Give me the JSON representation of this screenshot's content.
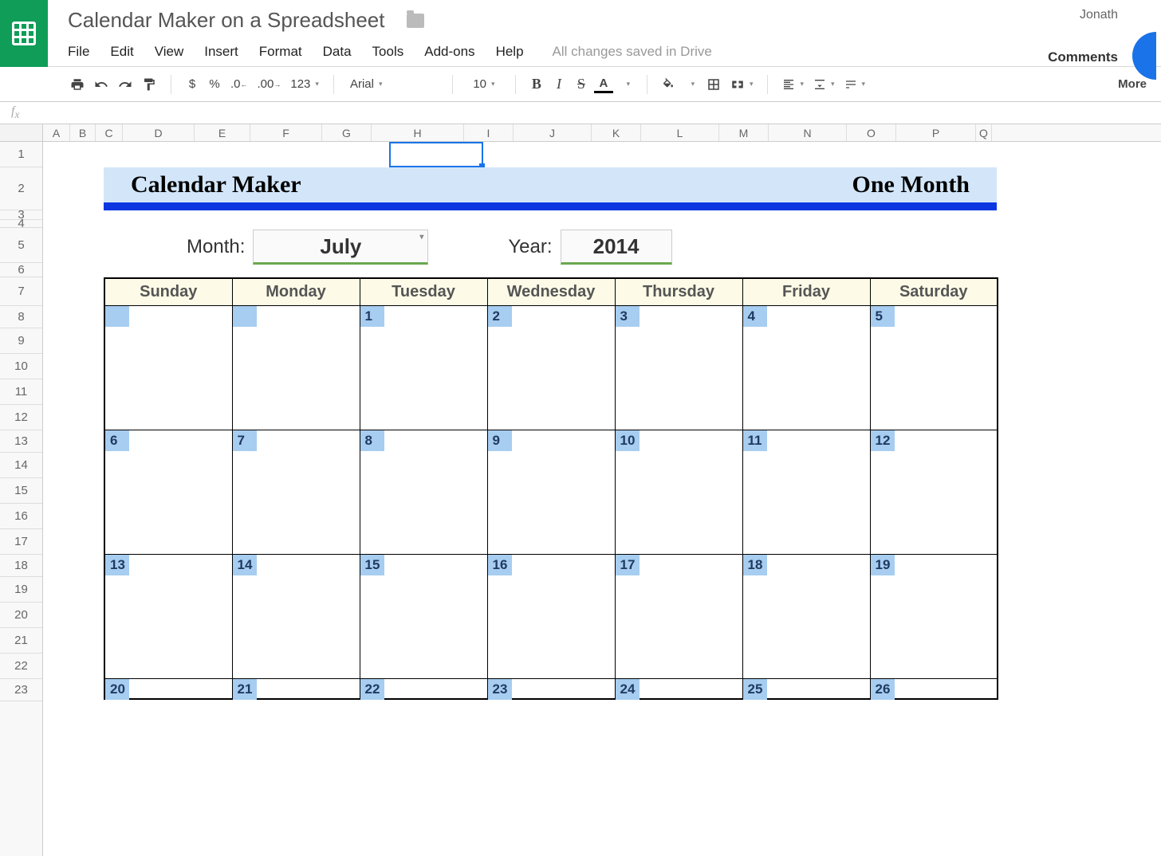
{
  "header": {
    "doc_title": "Calendar Maker on a Spreadsheet",
    "user": "Jonath",
    "comments": "Comments"
  },
  "menubar": [
    "File",
    "Edit",
    "View",
    "Insert",
    "Format",
    "Data",
    "Tools",
    "Add-ons",
    "Help"
  ],
  "save_status": "All changes saved in Drive",
  "toolbar": {
    "currency": "$",
    "percent": "%",
    "dec_dec": ".0",
    "dec_inc": ".00",
    "numfmt": "123",
    "font": "Arial",
    "size": "10",
    "bold": "B",
    "italic": "I",
    "strike": "S",
    "textA": "A",
    "more": "More"
  },
  "fx": "fx",
  "columns": [
    "A",
    "B",
    "C",
    "D",
    "E",
    "F",
    "G",
    "H",
    "I",
    "J",
    "K",
    "L",
    "M",
    "N",
    "O",
    "P",
    "Q"
  ],
  "rows": [
    "1",
    "2",
    "3",
    "4",
    "5",
    "6",
    "7",
    "8",
    "9",
    "10",
    "11",
    "12",
    "13",
    "14",
    "15",
    "16",
    "17",
    "18",
    "19",
    "20",
    "21",
    "22",
    "23"
  ],
  "banner": {
    "left": "Calendar Maker",
    "right": "One Month"
  },
  "controls": {
    "month_label": "Month:",
    "month_value": "July",
    "year_label": "Year:",
    "year_value": "2014"
  },
  "calendar": {
    "days": [
      "Sunday",
      "Monday",
      "Tuesday",
      "Wednesday",
      "Thursday",
      "Friday",
      "Saturday"
    ],
    "weeks": [
      [
        "",
        "",
        "1",
        "2",
        "3",
        "4",
        "5"
      ],
      [
        "6",
        "7",
        "8",
        "9",
        "10",
        "11",
        "12"
      ],
      [
        "13",
        "14",
        "15",
        "16",
        "17",
        "18",
        "19"
      ],
      [
        "20",
        "21",
        "22",
        "23",
        "24",
        "25",
        "26"
      ]
    ]
  }
}
